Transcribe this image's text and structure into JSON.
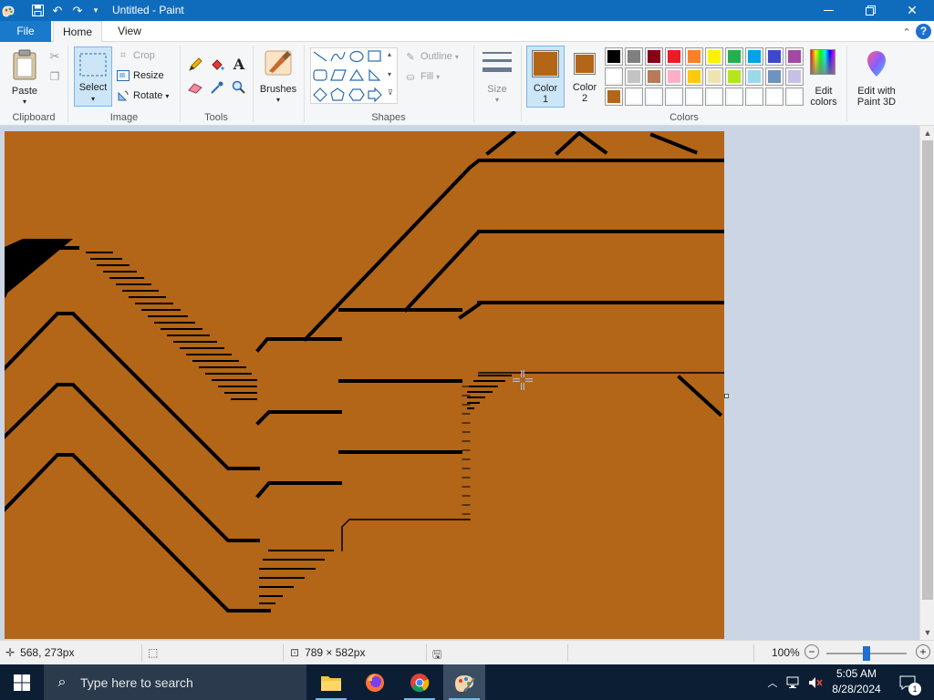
{
  "window": {
    "title": "Untitled - Paint",
    "minimize_icon": "minimize-icon",
    "maximize_icon": "maximize-icon",
    "close_icon": "close-icon"
  },
  "tabs": {
    "file": "File",
    "home": "Home",
    "view": "View"
  },
  "ribbon": {
    "clipboard": {
      "label": "Clipboard",
      "paste": "Paste"
    },
    "image": {
      "label": "Image",
      "select": "Select",
      "crop": "Crop",
      "resize": "Resize",
      "rotate": "Rotate"
    },
    "tools": {
      "label": "Tools"
    },
    "brushes": {
      "label": "Brushes"
    },
    "shapes": {
      "label": "Shapes",
      "outline": "Outline",
      "fill": "Fill"
    },
    "size": {
      "label": "Size"
    },
    "color1": {
      "label1": "Color",
      "label2": "1",
      "value": "#b36518"
    },
    "color2": {
      "label1": "Color",
      "label2": "2",
      "value": "#b36518"
    },
    "colors": {
      "label": "Colors",
      "row1": [
        "#000000",
        "#7f7f7f",
        "#880015",
        "#ed1c24",
        "#ff7f27",
        "#fff200",
        "#22b14c",
        "#00a2e8",
        "#3f48cc",
        "#a349a4"
      ],
      "row2": [
        "#ffffff",
        "#c3c3c3",
        "#b97a57",
        "#ffaec9",
        "#ffc90e",
        "#efe4b0",
        "#b5e61d",
        "#99d9ea",
        "#7092be",
        "#c8bfe7"
      ],
      "row3": [
        "#b36518",
        "#ffffff",
        "#ffffff",
        "#ffffff",
        "#ffffff",
        "#ffffff",
        "#ffffff",
        "#ffffff",
        "#ffffff",
        "#ffffff"
      ]
    },
    "edit_colors": {
      "line1": "Edit",
      "line2": "colors"
    },
    "paint3d": {
      "line1": "Edit with",
      "line2": "Paint 3D"
    }
  },
  "canvas": {
    "background": "#b36518",
    "cursor_icon": "crosshair-cursor-icon"
  },
  "status": {
    "cursor_pos": "568, 273px",
    "canvas_size": "789 × 582px",
    "zoom": "100%"
  },
  "taskbar": {
    "search_placeholder": "Type here to search",
    "time": "5:05 AM",
    "date": "8/28/2024",
    "notification_count": "1"
  }
}
